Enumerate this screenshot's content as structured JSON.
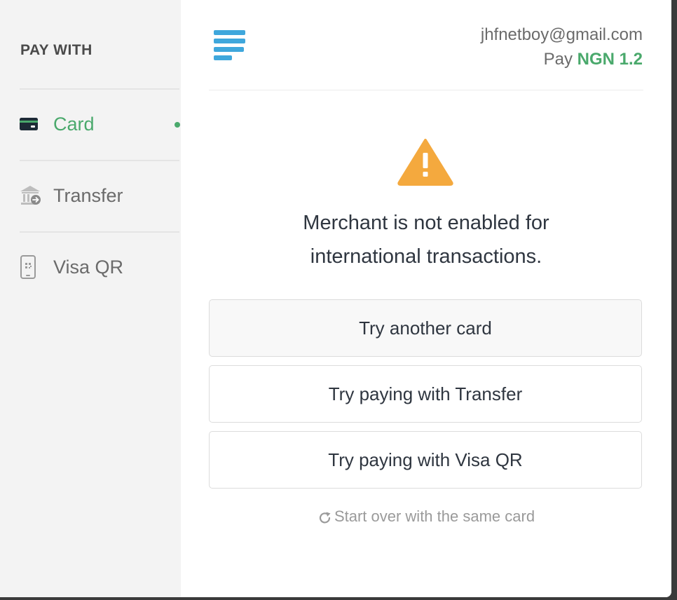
{
  "sidebar": {
    "heading": "PAY WITH",
    "items": [
      {
        "label": "Card",
        "icon": "card-icon",
        "active": true
      },
      {
        "label": "Transfer",
        "icon": "bank-transfer-icon",
        "active": false
      },
      {
        "label": "Visa QR",
        "icon": "phone-qr-icon",
        "active": false
      }
    ]
  },
  "header": {
    "logo": "paystack-logo",
    "email": "jhfnetboy@gmail.com",
    "pay_label": "Pay",
    "amount": "NGN 1.2"
  },
  "main": {
    "warning_icon": "warning-triangle-icon",
    "message_line1": "Merchant is not enabled for",
    "message_line2": "international transactions.",
    "buttons": [
      {
        "label": "Try another card"
      },
      {
        "label": "Try paying with Transfer"
      },
      {
        "label": "Try paying with Visa QR"
      }
    ],
    "restart_label": "Start over with the same card",
    "restart_icon": "refresh-icon"
  },
  "colors": {
    "accent": "#4aa96c",
    "warning": "#f4a93e",
    "logo_blue": "#3fa7dc",
    "text_dark": "#2f3640",
    "text_muted": "#6b6b6b"
  }
}
